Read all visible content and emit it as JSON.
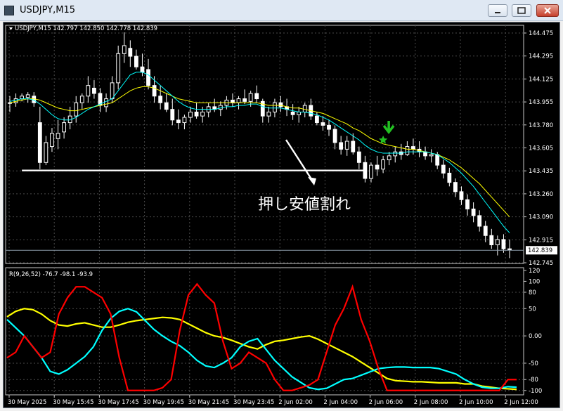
{
  "window": {
    "title": "USDJPY,M15"
  },
  "main_chart": {
    "header": "USDJPY,M15  142.797 142.850 142.778 142.839",
    "price_labels": [
      "144.475",
      "144.295",
      "144.125",
      "143.955",
      "143.780",
      "143.605",
      "143.435",
      "143.260",
      "143.090",
      "142.915",
      "142.745"
    ],
    "current_price": "142.839",
    "annotation": "押し安値割れ"
  },
  "indicator": {
    "header": "R(9,26,52) -76.7 -98.1 -93.9",
    "levels": [
      "120",
      "100",
      "80",
      "50",
      "0.00",
      "-50",
      "-80",
      "-100"
    ]
  },
  "time_labels": [
    "30 May 2025",
    "30 May 15:45",
    "30 May 17:45",
    "30 May 19:45",
    "30 May 21:45",
    "30 May 23:45",
    "2 Jun 02:00",
    "2 Jun 04:00",
    "2 Jun 06:00",
    "2 Jun 08:00",
    "2 Jun 10:00",
    "2 Jun 12:00"
  ],
  "colors": {
    "background": "#000000",
    "candles": "#ffffff",
    "sma_fast": "#00ffff",
    "sma_slow": "#ffff00",
    "line_red": "#ff0000",
    "arrow": "#22c022",
    "annotation_text": "#ffffff"
  },
  "chart_data": {
    "type": "candlestick",
    "main_ylim": [
      142.745,
      144.475
    ],
    "candles": [
      [
        143.95,
        144.0,
        143.88,
        143.95
      ],
      [
        143.95,
        144.02,
        143.92,
        143.98
      ],
      [
        143.98,
        144.02,
        143.96,
        144.0
      ],
      [
        143.99,
        144.03,
        143.95,
        144.01
      ],
      [
        144.0,
        144.03,
        143.92,
        143.95
      ],
      [
        143.8,
        143.92,
        143.45,
        143.5
      ],
      [
        143.5,
        143.7,
        143.48,
        143.65
      ],
      [
        143.62,
        143.76,
        143.58,
        143.72
      ],
      [
        143.68,
        143.82,
        143.6,
        143.72
      ],
      [
        143.73,
        143.84,
        143.68,
        143.8
      ],
      [
        143.8,
        143.92,
        143.75,
        143.85
      ],
      [
        143.85,
        144.0,
        143.8,
        143.95
      ],
      [
        143.95,
        144.02,
        143.9,
        144.0
      ],
      [
        144.0,
        144.15,
        143.95,
        144.08
      ],
      [
        144.06,
        144.12,
        143.98,
        144.02
      ],
      [
        144.02,
        144.06,
        143.88,
        143.93
      ],
      [
        143.92,
        144.02,
        143.88,
        143.98
      ],
      [
        143.98,
        144.15,
        143.95,
        144.1
      ],
      [
        144.1,
        144.38,
        144.05,
        144.32
      ],
      [
        144.32,
        144.48,
        144.25,
        144.38
      ],
      [
        144.36,
        144.42,
        144.22,
        144.3
      ],
      [
        144.3,
        144.35,
        144.2,
        144.22
      ],
      [
        144.22,
        144.32,
        144.15,
        144.18
      ],
      [
        144.2,
        144.28,
        144.05,
        144.08
      ],
      [
        144.08,
        144.15,
        143.95,
        144.0
      ],
      [
        144.0,
        144.08,
        143.9,
        143.95
      ],
      [
        143.95,
        144.02,
        143.88,
        143.9
      ],
      [
        143.9,
        143.98,
        143.78,
        143.82
      ],
      [
        143.82,
        143.9,
        143.75,
        143.8
      ],
      [
        143.8,
        143.86,
        143.75,
        143.84
      ],
      [
        143.84,
        143.92,
        143.8,
        143.88
      ],
      [
        143.88,
        143.95,
        143.83,
        143.85
      ],
      [
        143.85,
        143.92,
        143.8,
        143.88
      ],
      [
        143.88,
        143.95,
        143.84,
        143.92
      ],
      [
        143.92,
        143.98,
        143.88,
        143.9
      ],
      [
        143.9,
        143.96,
        143.85,
        143.93
      ],
      [
        143.93,
        144.0,
        143.9,
        143.97
      ],
      [
        143.97,
        144.02,
        143.92,
        143.95
      ],
      [
        143.95,
        144.0,
        143.9,
        143.98
      ],
      [
        143.98,
        144.05,
        143.94,
        143.96
      ],
      [
        143.96,
        144.04,
        143.92,
        144.02
      ],
      [
        144.02,
        144.08,
        143.95,
        143.98
      ],
      [
        143.96,
        143.98,
        143.8,
        143.85
      ],
      [
        143.85,
        143.92,
        143.8,
        143.88
      ],
      [
        143.88,
        143.98,
        143.84,
        143.95
      ],
      [
        143.95,
        144.0,
        143.88,
        143.92
      ],
      [
        143.92,
        143.98,
        143.85,
        143.9
      ],
      [
        143.88,
        143.94,
        143.82,
        143.86
      ],
      [
        143.86,
        143.92,
        143.8,
        143.88
      ],
      [
        143.88,
        143.95,
        143.84,
        143.93
      ],
      [
        143.93,
        143.98,
        143.82,
        143.85
      ],
      [
        143.85,
        143.88,
        143.78,
        143.8
      ],
      [
        143.8,
        143.85,
        143.74,
        143.78
      ],
      [
        143.78,
        143.82,
        143.7,
        143.75
      ],
      [
        143.75,
        143.78,
        143.6,
        143.65
      ],
      [
        143.65,
        143.7,
        143.56,
        143.6
      ],
      [
        143.6,
        143.7,
        143.55,
        143.66
      ],
      [
        143.66,
        143.72,
        143.56,
        143.58
      ],
      [
        143.58,
        143.62,
        143.45,
        143.5
      ],
      [
        143.5,
        143.55,
        143.35,
        143.38
      ],
      [
        143.38,
        143.5,
        143.35,
        143.48
      ],
      [
        143.48,
        143.55,
        143.4,
        143.45
      ],
      [
        143.45,
        143.55,
        143.42,
        143.52
      ],
      [
        143.52,
        143.58,
        143.48,
        143.55
      ],
      [
        143.55,
        143.62,
        143.5,
        143.58
      ],
      [
        143.58,
        143.64,
        143.52,
        143.56
      ],
      [
        143.56,
        143.66,
        143.55,
        143.62
      ],
      [
        143.62,
        143.68,
        143.56,
        143.6
      ],
      [
        143.6,
        143.66,
        143.54,
        143.58
      ],
      [
        143.58,
        143.62,
        143.52,
        143.55
      ],
      [
        143.55,
        143.6,
        143.5,
        143.56
      ],
      [
        143.56,
        143.58,
        143.45,
        143.48
      ],
      [
        143.48,
        143.52,
        143.38,
        143.42
      ],
      [
        143.42,
        143.46,
        143.32,
        143.35
      ],
      [
        143.35,
        143.38,
        143.24,
        143.28
      ],
      [
        143.28,
        143.32,
        143.18,
        143.22
      ],
      [
        143.22,
        143.26,
        143.1,
        143.15
      ],
      [
        143.15,
        143.2,
        143.05,
        143.1
      ],
      [
        143.1,
        143.14,
        142.98,
        143.02
      ],
      [
        143.02,
        143.06,
        142.9,
        142.95
      ],
      [
        142.95,
        143.0,
        142.85,
        142.88
      ],
      [
        142.88,
        142.95,
        142.8,
        142.92
      ],
      [
        142.92,
        142.96,
        142.82,
        142.85
      ],
      [
        142.85,
        142.92,
        142.78,
        142.84
      ]
    ],
    "sma_fast": [
      143.96,
      143.97,
      143.98,
      143.98,
      143.97,
      143.94,
      143.9,
      143.86,
      143.83,
      143.82,
      143.82,
      143.84,
      143.87,
      143.9,
      143.92,
      143.94,
      143.96,
      143.98,
      144.04,
      144.1,
      144.16,
      144.18,
      144.18,
      144.16,
      144.12,
      144.08,
      144.04,
      144.0,
      143.96,
      143.93,
      143.91,
      143.9,
      143.9,
      143.9,
      143.9,
      143.91,
      143.92,
      143.92,
      143.93,
      143.93,
      143.94,
      143.94,
      143.92,
      143.91,
      143.91,
      143.91,
      143.9,
      143.89,
      143.88,
      143.88,
      143.87,
      143.86,
      143.84,
      143.82,
      143.79,
      143.76,
      143.73,
      143.7,
      143.67,
      143.63,
      143.6,
      143.58,
      143.57,
      143.57,
      143.57,
      143.57,
      143.58,
      143.58,
      143.58,
      143.58,
      143.57,
      143.56,
      143.53,
      143.5,
      143.46,
      143.42,
      143.37,
      143.32,
      143.26,
      143.2,
      143.14,
      143.08,
      143.02,
      142.97
    ],
    "sma_slow": [
      143.95,
      143.96,
      143.97,
      143.98,
      143.98,
      143.97,
      143.95,
      143.93,
      143.91,
      143.9,
      143.89,
      143.89,
      143.9,
      143.91,
      143.92,
      143.93,
      143.94,
      143.95,
      143.98,
      144.01,
      144.04,
      144.06,
      144.07,
      144.07,
      144.06,
      144.04,
      144.02,
      144.0,
      143.98,
      143.97,
      143.96,
      143.95,
      143.95,
      143.95,
      143.95,
      143.95,
      143.95,
      143.95,
      143.95,
      143.95,
      143.95,
      143.95,
      143.94,
      143.93,
      143.93,
      143.93,
      143.92,
      143.91,
      143.91,
      143.9,
      143.89,
      143.88,
      143.87,
      143.85,
      143.83,
      143.81,
      143.79,
      143.76,
      143.74,
      143.71,
      143.68,
      143.66,
      143.64,
      143.63,
      143.62,
      143.61,
      143.6,
      143.6,
      143.59,
      143.58,
      143.57,
      143.56,
      143.54,
      143.52,
      143.49,
      143.46,
      143.42,
      143.38,
      143.34,
      143.29,
      143.24,
      143.19,
      143.14,
      143.09
    ],
    "horizontal_line": 143.44,
    "indicator_ylim": [
      -108,
      125
    ],
    "indicator_series": [
      {
        "color": "#ffff00",
        "values": [
          35,
          45,
          50,
          48,
          40,
          28,
          20,
          18,
          22,
          24,
          20,
          16,
          16,
          20,
          25,
          28,
          30,
          32,
          34,
          33,
          30,
          22,
          14,
          6,
          0,
          -3,
          -8,
          -14,
          -20,
          -24,
          -16,
          -10,
          -8,
          -5,
          -2,
          0,
          -6,
          -14,
          -22,
          -30,
          -38,
          -48,
          -58,
          -68,
          -78,
          -82,
          -83,
          -84,
          -84,
          -85,
          -86,
          -86,
          -86,
          -88,
          -88,
          -92,
          -94,
          -96,
          -97,
          -98
        ]
      },
      {
        "color": "#00ffff",
        "values": [
          30,
          15,
          0,
          -20,
          -40,
          -65,
          -70,
          -62,
          -50,
          -38,
          -20,
          10,
          32,
          45,
          50,
          44,
          28,
          12,
          0,
          -10,
          -18,
          -30,
          -45,
          -55,
          -58,
          -50,
          -40,
          -20,
          -10,
          -5,
          -25,
          -45,
          -60,
          -75,
          -85,
          -95,
          -98,
          -96,
          -88,
          -80,
          -78,
          -72,
          -66,
          -60,
          -58,
          -57,
          -57,
          -58,
          -58,
          -58,
          -60,
          -65,
          -70,
          -80,
          -88,
          -94,
          -96,
          -96,
          -93,
          -94
        ]
      },
      {
        "color": "#ff0000",
        "values": [
          -40,
          -30,
          0,
          -20,
          -40,
          -30,
          40,
          70,
          90,
          90,
          80,
          70,
          40,
          -40,
          -100,
          -100,
          -100,
          -100,
          -95,
          -80,
          10,
          75,
          95,
          75,
          60,
          -10,
          -60,
          -50,
          -30,
          -40,
          -50,
          -80,
          -100,
          -100,
          -95,
          -90,
          -80,
          -30,
          20,
          50,
          90,
          30,
          -10,
          -60,
          -100,
          -100,
          -100,
          -100,
          -100,
          -100,
          -100,
          -100,
          -100,
          -100,
          -100,
          -100,
          -100,
          -100,
          -80,
          -80
        ]
      }
    ]
  }
}
